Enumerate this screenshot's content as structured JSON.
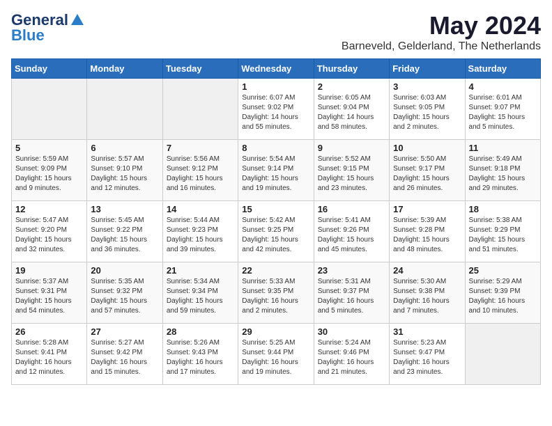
{
  "logo": {
    "general": "General",
    "blue": "Blue"
  },
  "title": "May 2024",
  "location": "Barneveld, Gelderland, The Netherlands",
  "weekdays": [
    "Sunday",
    "Monday",
    "Tuesday",
    "Wednesday",
    "Thursday",
    "Friday",
    "Saturday"
  ],
  "weeks": [
    [
      {
        "day": "",
        "info": ""
      },
      {
        "day": "",
        "info": ""
      },
      {
        "day": "",
        "info": ""
      },
      {
        "day": "1",
        "info": "Sunrise: 6:07 AM\nSunset: 9:02 PM\nDaylight: 14 hours\nand 55 minutes."
      },
      {
        "day": "2",
        "info": "Sunrise: 6:05 AM\nSunset: 9:04 PM\nDaylight: 14 hours\nand 58 minutes."
      },
      {
        "day": "3",
        "info": "Sunrise: 6:03 AM\nSunset: 9:05 PM\nDaylight: 15 hours\nand 2 minutes."
      },
      {
        "day": "4",
        "info": "Sunrise: 6:01 AM\nSunset: 9:07 PM\nDaylight: 15 hours\nand 5 minutes."
      }
    ],
    [
      {
        "day": "5",
        "info": "Sunrise: 5:59 AM\nSunset: 9:09 PM\nDaylight: 15 hours\nand 9 minutes."
      },
      {
        "day": "6",
        "info": "Sunrise: 5:57 AM\nSunset: 9:10 PM\nDaylight: 15 hours\nand 12 minutes."
      },
      {
        "day": "7",
        "info": "Sunrise: 5:56 AM\nSunset: 9:12 PM\nDaylight: 15 hours\nand 16 minutes."
      },
      {
        "day": "8",
        "info": "Sunrise: 5:54 AM\nSunset: 9:14 PM\nDaylight: 15 hours\nand 19 minutes."
      },
      {
        "day": "9",
        "info": "Sunrise: 5:52 AM\nSunset: 9:15 PM\nDaylight: 15 hours\nand 23 minutes."
      },
      {
        "day": "10",
        "info": "Sunrise: 5:50 AM\nSunset: 9:17 PM\nDaylight: 15 hours\nand 26 minutes."
      },
      {
        "day": "11",
        "info": "Sunrise: 5:49 AM\nSunset: 9:18 PM\nDaylight: 15 hours\nand 29 minutes."
      }
    ],
    [
      {
        "day": "12",
        "info": "Sunrise: 5:47 AM\nSunset: 9:20 PM\nDaylight: 15 hours\nand 32 minutes."
      },
      {
        "day": "13",
        "info": "Sunrise: 5:45 AM\nSunset: 9:22 PM\nDaylight: 15 hours\nand 36 minutes."
      },
      {
        "day": "14",
        "info": "Sunrise: 5:44 AM\nSunset: 9:23 PM\nDaylight: 15 hours\nand 39 minutes."
      },
      {
        "day": "15",
        "info": "Sunrise: 5:42 AM\nSunset: 9:25 PM\nDaylight: 15 hours\nand 42 minutes."
      },
      {
        "day": "16",
        "info": "Sunrise: 5:41 AM\nSunset: 9:26 PM\nDaylight: 15 hours\nand 45 minutes."
      },
      {
        "day": "17",
        "info": "Sunrise: 5:39 AM\nSunset: 9:28 PM\nDaylight: 15 hours\nand 48 minutes."
      },
      {
        "day": "18",
        "info": "Sunrise: 5:38 AM\nSunset: 9:29 PM\nDaylight: 15 hours\nand 51 minutes."
      }
    ],
    [
      {
        "day": "19",
        "info": "Sunrise: 5:37 AM\nSunset: 9:31 PM\nDaylight: 15 hours\nand 54 minutes."
      },
      {
        "day": "20",
        "info": "Sunrise: 5:35 AM\nSunset: 9:32 PM\nDaylight: 15 hours\nand 57 minutes."
      },
      {
        "day": "21",
        "info": "Sunrise: 5:34 AM\nSunset: 9:34 PM\nDaylight: 15 hours\nand 59 minutes."
      },
      {
        "day": "22",
        "info": "Sunrise: 5:33 AM\nSunset: 9:35 PM\nDaylight: 16 hours\nand 2 minutes."
      },
      {
        "day": "23",
        "info": "Sunrise: 5:31 AM\nSunset: 9:37 PM\nDaylight: 16 hours\nand 5 minutes."
      },
      {
        "day": "24",
        "info": "Sunrise: 5:30 AM\nSunset: 9:38 PM\nDaylight: 16 hours\nand 7 minutes."
      },
      {
        "day": "25",
        "info": "Sunrise: 5:29 AM\nSunset: 9:39 PM\nDaylight: 16 hours\nand 10 minutes."
      }
    ],
    [
      {
        "day": "26",
        "info": "Sunrise: 5:28 AM\nSunset: 9:41 PM\nDaylight: 16 hours\nand 12 minutes."
      },
      {
        "day": "27",
        "info": "Sunrise: 5:27 AM\nSunset: 9:42 PM\nDaylight: 16 hours\nand 15 minutes."
      },
      {
        "day": "28",
        "info": "Sunrise: 5:26 AM\nSunset: 9:43 PM\nDaylight: 16 hours\nand 17 minutes."
      },
      {
        "day": "29",
        "info": "Sunrise: 5:25 AM\nSunset: 9:44 PM\nDaylight: 16 hours\nand 19 minutes."
      },
      {
        "day": "30",
        "info": "Sunrise: 5:24 AM\nSunset: 9:46 PM\nDaylight: 16 hours\nand 21 minutes."
      },
      {
        "day": "31",
        "info": "Sunrise: 5:23 AM\nSunset: 9:47 PM\nDaylight: 16 hours\nand 23 minutes."
      },
      {
        "day": "",
        "info": ""
      }
    ]
  ]
}
